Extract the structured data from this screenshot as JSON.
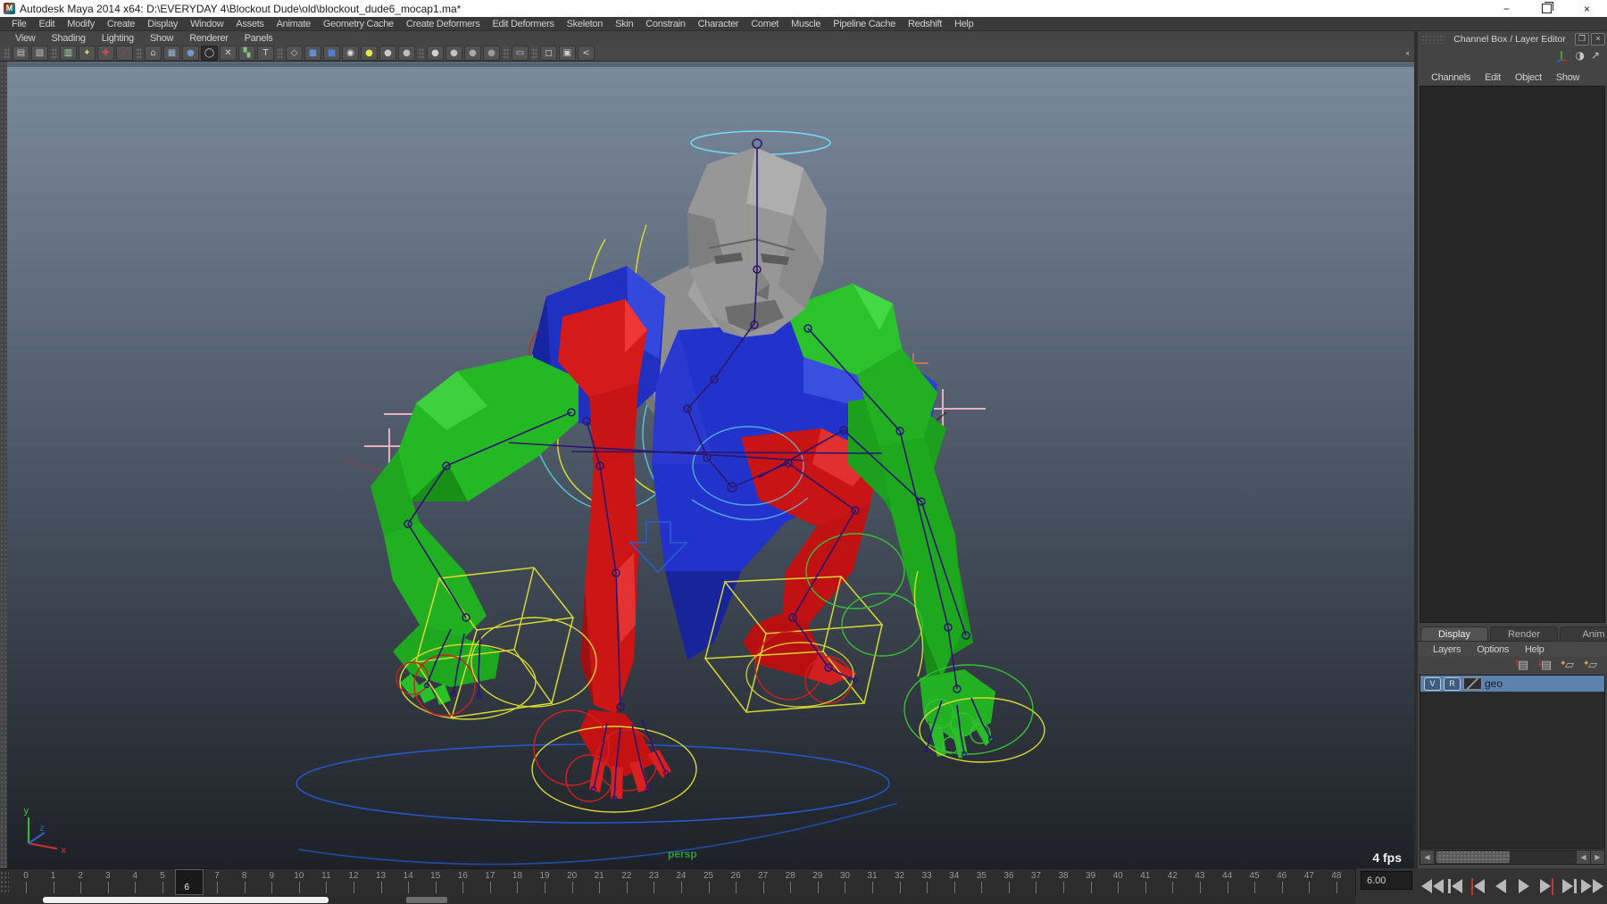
{
  "window": {
    "title": "Autodesk Maya 2014 x64: D:\\EVERYDAY 4\\Blockout Dude\\old\\blockout_dude6_mocap1.ma*",
    "controls": {
      "minimize": "−",
      "close": "×"
    }
  },
  "menubar": {
    "items": [
      "File",
      "Edit",
      "Modify",
      "Create",
      "Display",
      "Window",
      "Assets",
      "Animate",
      "Geometry Cache",
      "Create Deformers",
      "Edit Deformers",
      "Skeleton",
      "Skin",
      "Constrain",
      "Character",
      "Comet",
      "Muscle",
      "Pipeline Cache",
      "Redshift",
      "Help"
    ]
  },
  "panel_menubar": {
    "items": [
      "View",
      "Shading",
      "Lighting",
      "Show",
      "Renderer",
      "Panels"
    ]
  },
  "toolbar": {
    "icons": [
      {
        "sep": true
      },
      {
        "name": "select-by-hierarchy-icon",
        "glyph": "▤",
        "color": "#c0c0c0"
      },
      {
        "name": "select-by-object-icon",
        "glyph": "▧",
        "color": "#c0c0c0"
      },
      {
        "sep": true
      },
      {
        "name": "selection-mask-icon",
        "glyph": "▥",
        "color": "#9fd89f"
      },
      {
        "name": "lasso-select-icon",
        "glyph": "✦",
        "color": "#d8d86a"
      },
      {
        "name": "snap-move-tool-icon",
        "glyph": "✚",
        "color": "#d05050"
      },
      {
        "name": "paint-brush-icon",
        "glyph": "／",
        "color": "#cc4444"
      },
      {
        "sep": true
      },
      {
        "name": "snap-to-grid-icon",
        "glyph": "⌂",
        "color": "#c0c0c0"
      },
      {
        "name": "grid-icon",
        "glyph": "▦",
        "color": "#9ab4d8"
      },
      {
        "name": "snap-to-point-icon",
        "glyph": "●",
        "color": "#6f9ad0"
      },
      {
        "name": "snap-to-curve-icon",
        "glyph": "◯",
        "color": "#cccccc",
        "pressed": true
      },
      {
        "name": "snap-to-plane-icon",
        "glyph": "✕",
        "color": "#cccccc"
      },
      {
        "name": "make-live-icon",
        "glyph": "▚",
        "color": "#7fc57f"
      },
      {
        "name": "text-tool-icon",
        "glyph": "T",
        "color": "#bfe0bf"
      },
      {
        "sep": true
      },
      {
        "name": "render-cube-icon",
        "glyph": "◇",
        "color": "#cccccc"
      },
      {
        "name": "render-view-icon",
        "glyph": "■",
        "color": "#5f8fd0"
      },
      {
        "name": "render-current-frame-icon",
        "glyph": "■",
        "color": "#4f7fc8"
      },
      {
        "name": "ipr-render-icon",
        "glyph": "◉",
        "color": "#dddddd"
      },
      {
        "name": "render-settings-icon",
        "glyph": "●",
        "color": "#e8e84a"
      },
      {
        "name": "shaded-sphere-icon",
        "glyph": "●",
        "color": "#c9c9c9"
      },
      {
        "name": "shaded-sphere-icon",
        "glyph": "●",
        "color": "#bdbdbd"
      },
      {
        "sep": true
      },
      {
        "name": "material-sphere-icon",
        "glyph": "●",
        "color": "#cfcfcf"
      },
      {
        "name": "material-sphere-icon",
        "glyph": "●",
        "color": "#c4c4c4"
      },
      {
        "name": "material-sphere-icon",
        "glyph": "●",
        "color": "#a9a9a9"
      },
      {
        "name": "material-sphere-icon",
        "glyph": "●",
        "color": "#9a9a9a"
      },
      {
        "sep": true
      },
      {
        "name": "selection-marquee-icon",
        "glyph": "▭",
        "color": "#b9d2ea"
      },
      {
        "sep": true
      },
      {
        "name": "cube-outline-icon",
        "glyph": "◻",
        "color": "#cccccc"
      },
      {
        "name": "duplicate-icon",
        "glyph": "▣",
        "color": "#cccccc"
      },
      {
        "name": "share-node-icon",
        "glyph": "<",
        "color": "#cccccc"
      }
    ],
    "collapse_arrow": "◂"
  },
  "viewport": {
    "camera_label": "persp",
    "fps_label": "4 fps",
    "axis": {
      "x": "x",
      "y": "y",
      "z": "z"
    },
    "colors": {
      "bg_top": "#7b8a9c",
      "bg_bottom": "#1e2126",
      "body_red": "#cc1515",
      "body_green": "#22b822",
      "body_blue": "#2233cc",
      "head_gray": "#979797",
      "skeleton": "#2a1670",
      "control_yellow": "#d8d832",
      "control_cyan": "#5fd0ea",
      "ground_blue": "#2458c8"
    }
  },
  "channel_box": {
    "title": "Channel Box / Layer Editor",
    "menus": [
      "Channels",
      "Edit",
      "Object",
      "Show"
    ],
    "header_icons": [
      {
        "name": "contrast-toggle-icon",
        "glyph": "◑"
      },
      {
        "name": "pop-out-arrow-icon",
        "glyph": "↗"
      }
    ]
  },
  "layer_editor": {
    "tabs": [
      {
        "label": "Display",
        "active": true
      },
      {
        "label": "Render",
        "active": false
      },
      {
        "label": "Anim",
        "active": false
      }
    ],
    "menus": [
      "Layers",
      "Options",
      "Help"
    ],
    "toolbar_icons": [
      {
        "name": "move-layer-up-icon",
        "glyph": "▤",
        "overlay": "↑",
        "overlay_color": "#d03030"
      },
      {
        "name": "move-layer-down-icon",
        "glyph": "▤",
        "overlay": "↓",
        "overlay_color": "#d03030"
      },
      {
        "name": "new-empty-layer-icon",
        "glyph": "▱",
        "overlay": "✦",
        "overlay_color": "#e8a030"
      },
      {
        "name": "new-layer-from-selected-icon",
        "glyph": "▱",
        "overlay": "✦",
        "overlay_color": "#e8a030"
      }
    ],
    "layers": [
      {
        "visible_label": "V",
        "renderable_label": "R",
        "name": "geo",
        "selected": true
      }
    ]
  },
  "timeline": {
    "start": 0,
    "end": 48,
    "current": 6,
    "current_label": "6",
    "time_field": "6.00"
  },
  "playback": {
    "buttons": [
      {
        "name": "go-to-start-button",
        "parts": [
          "bar",
          "tl",
          "tl"
        ]
      },
      {
        "name": "step-back-frame-button",
        "parts": [
          "bar",
          "tl"
        ]
      },
      {
        "name": "step-back-key-button",
        "parts": [
          "red",
          "tl"
        ]
      },
      {
        "name": "play-backwards-button",
        "parts": [
          "tl"
        ]
      },
      {
        "name": "play-forwards-button",
        "parts": [
          "tr"
        ]
      },
      {
        "name": "step-forward-key-button",
        "parts": [
          "tr",
          "red"
        ]
      },
      {
        "name": "step-forward-frame-button",
        "parts": [
          "tr",
          "bar"
        ]
      },
      {
        "name": "go-to-end-button",
        "parts": [
          "tr",
          "tr",
          "bar"
        ]
      }
    ]
  }
}
